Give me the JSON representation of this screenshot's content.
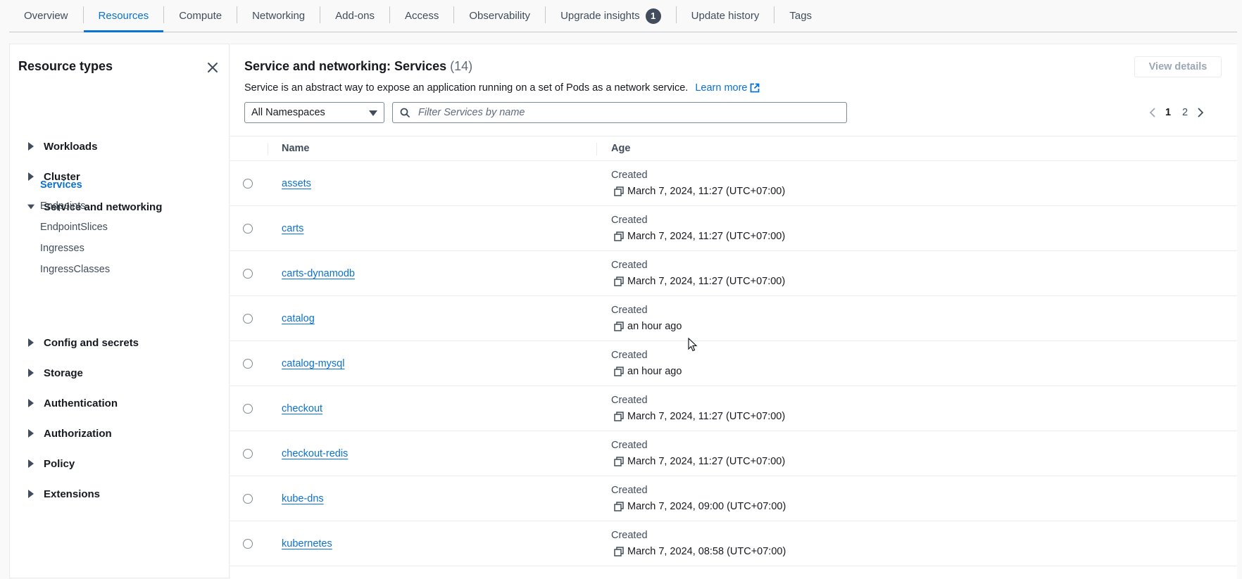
{
  "tabs": [
    {
      "label": "Overview"
    },
    {
      "label": "Resources",
      "active": true
    },
    {
      "label": "Compute"
    },
    {
      "label": "Networking"
    },
    {
      "label": "Add-ons"
    },
    {
      "label": "Access"
    },
    {
      "label": "Observability"
    },
    {
      "label": "Upgrade insights",
      "badge": "1"
    },
    {
      "label": "Update history"
    },
    {
      "label": "Tags"
    }
  ],
  "sidebar": {
    "title": "Resource types",
    "groups": [
      {
        "label": "Workloads",
        "expanded": false
      },
      {
        "label": "Cluster",
        "expanded": false
      },
      {
        "label": "Service and networking",
        "expanded": true,
        "items": [
          "Services",
          "Endpoints",
          "EndpointSlices",
          "Ingresses",
          "IngressClasses"
        ],
        "active_item": "Services"
      },
      {
        "label": "Config and secrets",
        "expanded": false
      },
      {
        "label": "Storage",
        "expanded": false
      },
      {
        "label": "Authentication",
        "expanded": false
      },
      {
        "label": "Authorization",
        "expanded": false
      },
      {
        "label": "Policy",
        "expanded": false
      },
      {
        "label": "Extensions",
        "expanded": false
      }
    ]
  },
  "main": {
    "title": "Service and networking: Services",
    "count": "(14)",
    "view_details_label": "View details",
    "description": "Service is an abstract way to expose an application running on a set of Pods as a network service.",
    "learn_more": "Learn more",
    "namespace_select": "All Namespaces",
    "filter_placeholder": "Filter Services by name",
    "pagination": {
      "pages": [
        "1",
        "2"
      ],
      "current": "1"
    },
    "columns": {
      "name": "Name",
      "age": "Age"
    },
    "rows": [
      {
        "name": "assets",
        "created_label": "Created",
        "created": "March 7, 2024, 11:27 (UTC+07:00)"
      },
      {
        "name": "carts",
        "created_label": "Created",
        "created": "March 7, 2024, 11:27 (UTC+07:00)"
      },
      {
        "name": "carts-dynamodb",
        "created_label": "Created",
        "created": "March 7, 2024, 11:27 (UTC+07:00)"
      },
      {
        "name": "catalog",
        "created_label": "Created",
        "created": "an hour ago"
      },
      {
        "name": "catalog-mysql",
        "created_label": "Created",
        "created": "an hour ago"
      },
      {
        "name": "checkout",
        "created_label": "Created",
        "created": "March 7, 2024, 11:27 (UTC+07:00)"
      },
      {
        "name": "checkout-redis",
        "created_label": "Created",
        "created": "March 7, 2024, 11:27 (UTC+07:00)"
      },
      {
        "name": "kube-dns",
        "created_label": "Created",
        "created": "March 7, 2024, 09:00 (UTC+07:00)"
      },
      {
        "name": "kubernetes",
        "created_label": "Created",
        "created": "March 7, 2024, 08:58 (UTC+07:00)"
      }
    ]
  },
  "colors": {
    "accent": "#0972d3",
    "text": "#16191f",
    "muted": "#414d5c",
    "border": "#e9ebed"
  }
}
